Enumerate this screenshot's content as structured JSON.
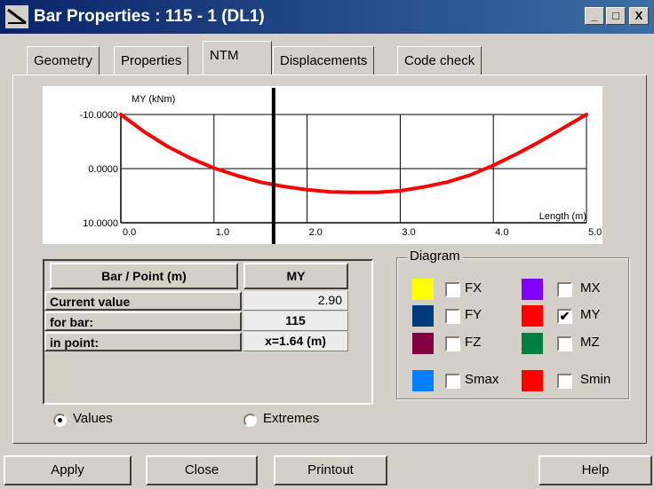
{
  "window": {
    "title": "Bar Properties : 115 - 1 (DL1)",
    "minimize": "_",
    "maximize": "□",
    "close": "X"
  },
  "tabs": [
    {
      "label": "Geometry"
    },
    {
      "label": "Properties"
    },
    {
      "label": "NTM"
    },
    {
      "label": "Displacements"
    },
    {
      "label": "Code check"
    }
  ],
  "active_tab": "NTM",
  "chart_data": {
    "type": "line",
    "ylabel": "MY (kNm)",
    "xlabel": "Length (m)",
    "xlim": [
      0,
      5
    ],
    "ylim": [
      -10,
      10
    ],
    "y_inverted": true,
    "x_ticks": [
      "0.0",
      "1.0",
      "2.0",
      "3.0",
      "4.0",
      "5.0"
    ],
    "y_ticks": [
      "-10.0000",
      "0.0000",
      "10.0000"
    ],
    "grid": true,
    "cursor_x": 1.64,
    "series": [
      {
        "x": [
          0,
          0.25,
          0.5,
          0.75,
          1.0,
          1.25,
          1.5,
          1.75,
          2.0,
          2.25,
          2.5,
          2.75,
          3.0,
          3.25,
          3.5,
          3.75,
          4.0,
          4.25,
          4.5,
          4.75,
          5.0
        ],
        "y": [
          -10.0,
          -6.8,
          -4.1,
          -1.9,
          -0.1,
          1.3,
          2.5,
          3.3,
          3.9,
          4.3,
          4.4,
          4.4,
          4.1,
          3.4,
          2.5,
          1.2,
          -0.6,
          -2.7,
          -5.0,
          -7.5,
          -10.0
        ],
        "color": "#ff0000"
      }
    ]
  },
  "table": {
    "header_left": "Bar / Point (m)",
    "header_right": "MY",
    "rows": [
      {
        "label": "Current value",
        "value": "2.90"
      },
      {
        "label": "for bar:",
        "value": "115"
      },
      {
        "label": "in point:",
        "value": "x=1.64 (m)"
      }
    ]
  },
  "diagram": {
    "title": "Diagram",
    "items": [
      {
        "label": "FX",
        "color": "#ffff00",
        "checked": false
      },
      {
        "label": "MX",
        "color": "#8000ff",
        "checked": false
      },
      {
        "label": "FY",
        "color": "#003c7c",
        "checked": false
      },
      {
        "label": "MY",
        "color": "#ff0000",
        "checked": true
      },
      {
        "label": "FZ",
        "color": "#800040",
        "checked": false
      },
      {
        "label": "MZ",
        "color": "#008040",
        "checked": false
      },
      {
        "label": "Smax",
        "color": "#0080ff",
        "checked": false
      },
      {
        "label": "Smin",
        "color": "#ff0000",
        "checked": false
      }
    ]
  },
  "mode": {
    "options": [
      {
        "label": "Values",
        "selected": true
      },
      {
        "label": "Extremes",
        "selected": false
      }
    ]
  },
  "buttons": {
    "apply": "Apply",
    "close": "Close",
    "printout": "Printout",
    "help": "Help"
  }
}
